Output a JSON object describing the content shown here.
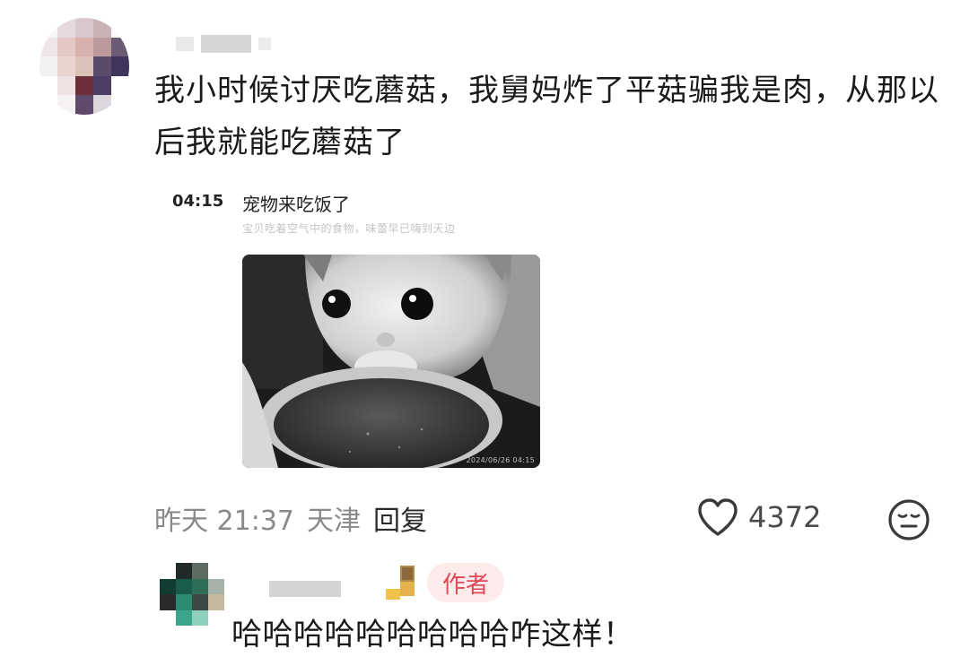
{
  "comment": {
    "text": "我小时候讨厌吃蘑菇，我舅妈炸了平菇骗我是肉，从那以后我就能吃蘑菇了",
    "embedded_screenshot": {
      "time": "04:15",
      "title": "宠物来吃饭了",
      "subtitle": "宝贝吃着空气中的食物，味蕾早已嗨到天边",
      "camera_stamp": "2024/06/26 04:15"
    },
    "meta": {
      "time": "昨天 21:37",
      "location": "天津",
      "reply_label": "回复"
    },
    "like_count": "4372",
    "icons": {
      "like": "heart-outline-icon",
      "reaction": "neutral-face-icon"
    }
  },
  "reply": {
    "author_tag": "作者",
    "text": "哈哈哈哈哈哈哈哈哈咋这样！",
    "colors": {
      "author_tag_text": "#e0485a",
      "author_tag_bg": "#fdeaea"
    }
  }
}
